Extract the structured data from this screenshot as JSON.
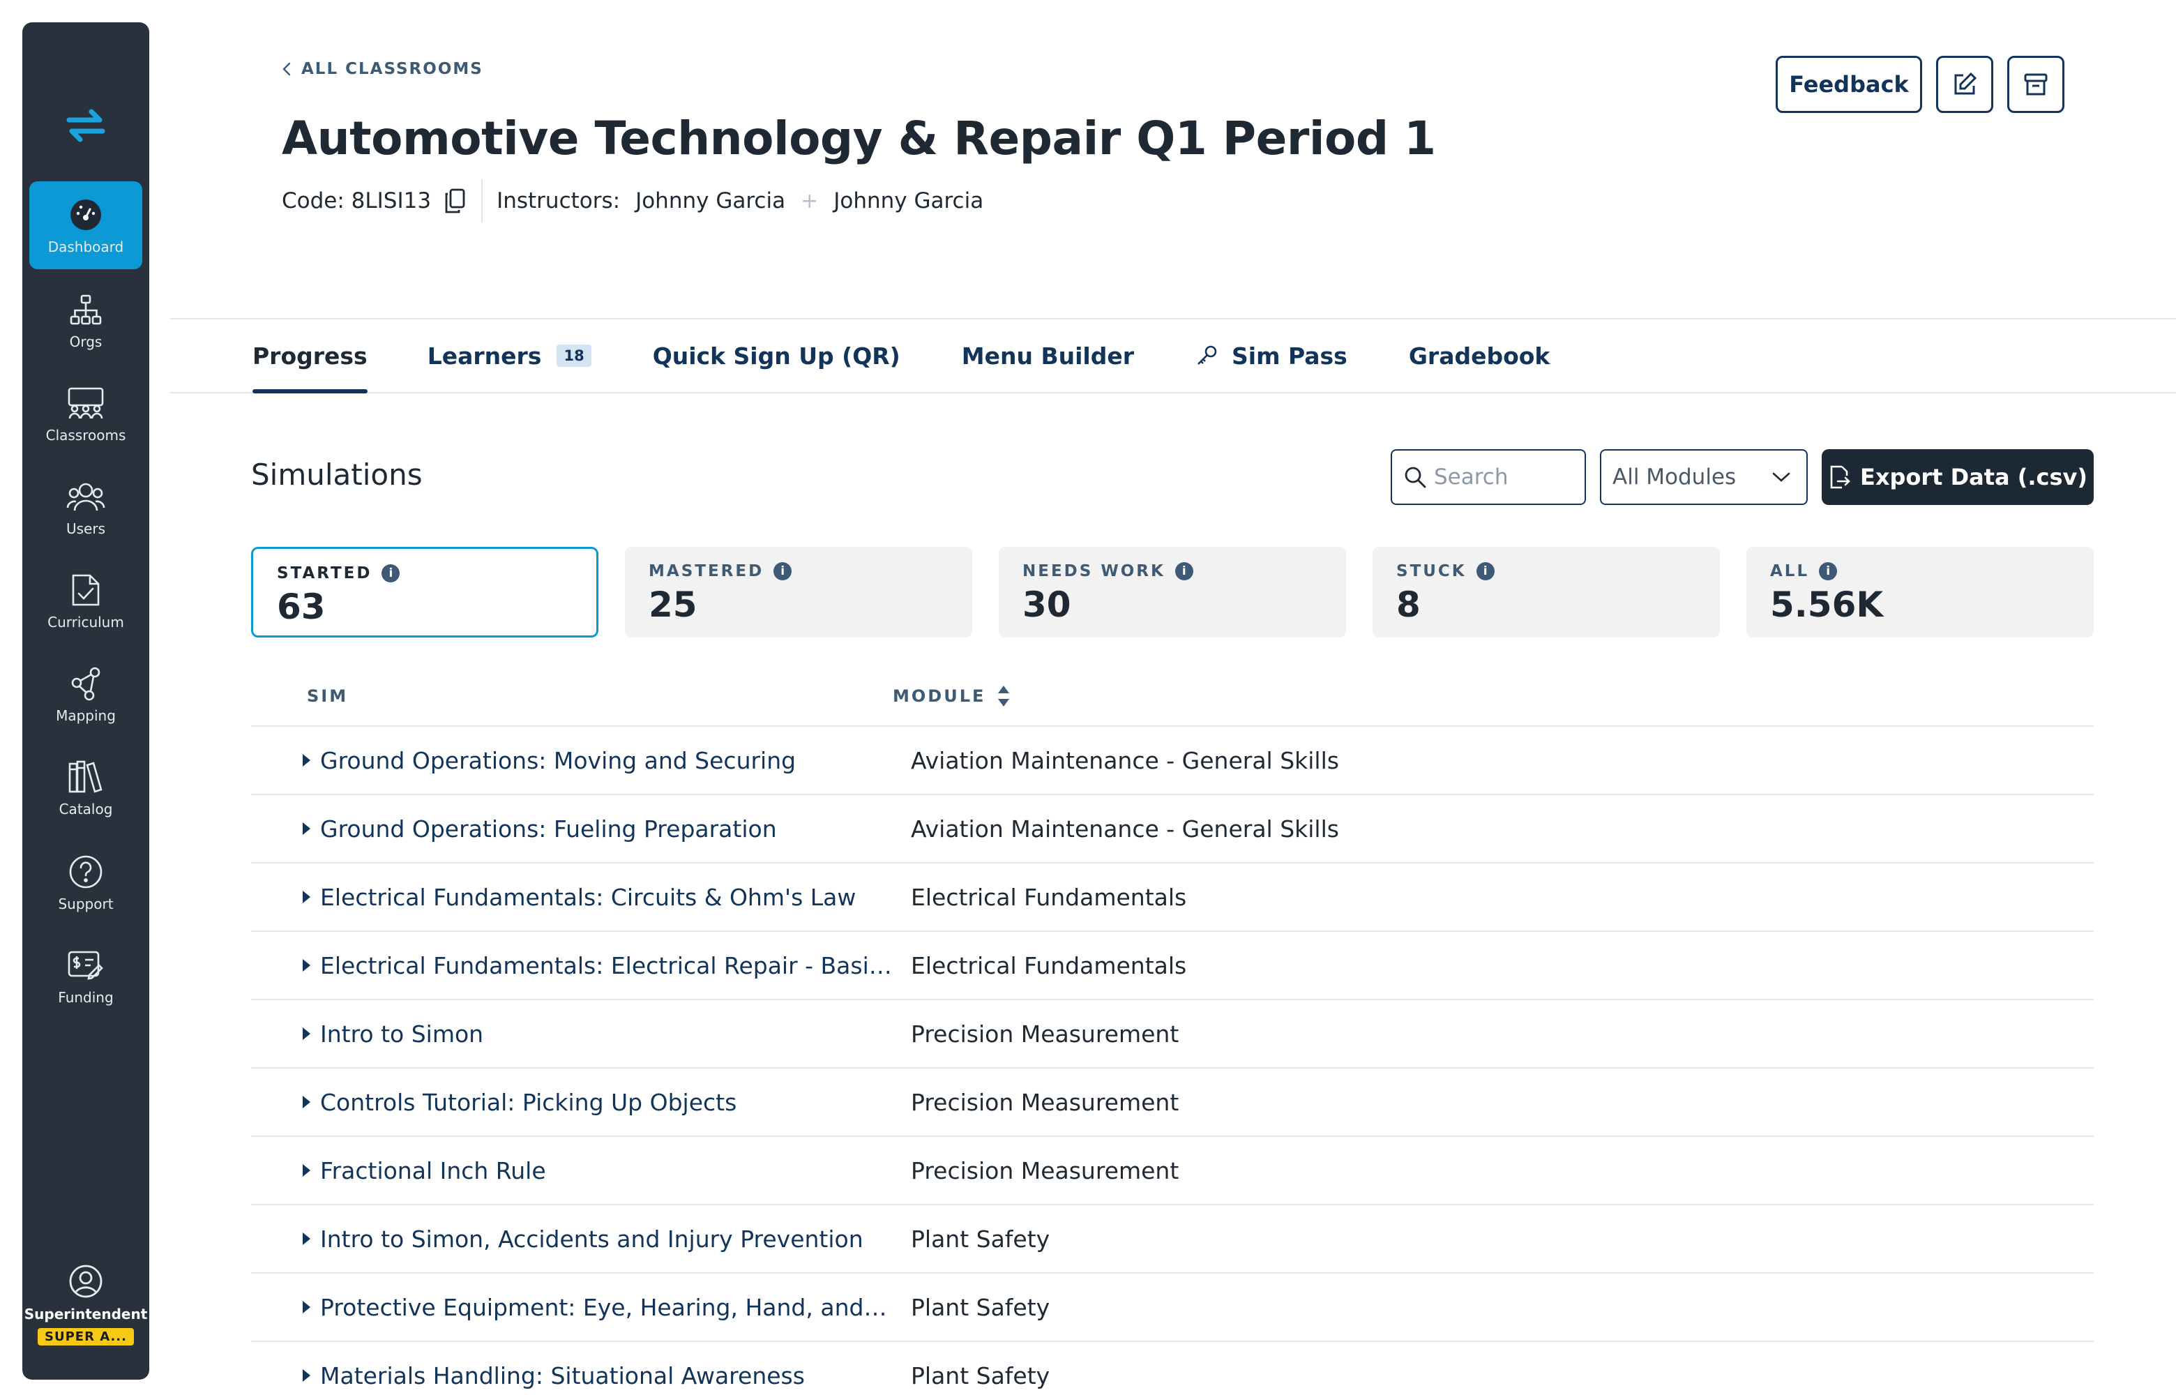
{
  "sidebar": {
    "items": [
      {
        "label": "Dashboard",
        "icon": "gauge-icon"
      },
      {
        "label": "Orgs",
        "icon": "org-chart-icon"
      },
      {
        "label": "Classrooms",
        "icon": "classroom-icon"
      },
      {
        "label": "Users",
        "icon": "users-icon"
      },
      {
        "label": "Curriculum",
        "icon": "document-check-icon"
      },
      {
        "label": "Mapping",
        "icon": "share-nodes-icon"
      },
      {
        "label": "Catalog",
        "icon": "books-icon"
      },
      {
        "label": "Support",
        "icon": "question-circle-icon"
      },
      {
        "label": "Funding",
        "icon": "funding-icon"
      }
    ],
    "user": {
      "name": "Superintendent",
      "role": "SUPER A..."
    }
  },
  "header": {
    "breadcrumb": "ALL CLASSROOMS",
    "title": "Automotive Technology & Repair Q1 Period 1",
    "code": "Code: 8LISI13",
    "instructors_label": "Instructors:",
    "instructors": [
      "Johnny Garcia",
      "Johnny Garcia"
    ],
    "feedback_label": "Feedback"
  },
  "tabs": [
    {
      "label": "Progress",
      "active": true
    },
    {
      "label": "Learners",
      "count": "18"
    },
    {
      "label": "Quick Sign Up (QR)"
    },
    {
      "label": "Menu Builder"
    },
    {
      "label": "Sim Pass",
      "icon": "key-icon"
    },
    {
      "label": "Gradebook"
    }
  ],
  "simulations": {
    "title": "Simulations",
    "search_placeholder": "Search",
    "module_filter": "All Modules",
    "export_label": "Export Data (.csv)",
    "stats": [
      {
        "label": "STARTED",
        "value": "63",
        "active": true
      },
      {
        "label": "MASTERED",
        "value": "25"
      },
      {
        "label": "NEEDS WORK",
        "value": "30"
      },
      {
        "label": "STUCK",
        "value": "8"
      },
      {
        "label": "ALL",
        "value": "5.56K"
      }
    ],
    "columns": {
      "sim": "SIM",
      "module": "MODULE"
    },
    "rows": [
      {
        "sim": "Ground Operations: Moving and Securing",
        "module": "Aviation Maintenance - General Skills"
      },
      {
        "sim": "Ground Operations: Fueling Preparation",
        "module": "Aviation Maintenance - General Skills"
      },
      {
        "sim": "Electrical Fundamentals: Circuits & Ohm's Law",
        "module": "Electrical Fundamentals"
      },
      {
        "sim": "Electrical Fundamentals: Electrical Repair - Basic ...",
        "module": "Electrical Fundamentals"
      },
      {
        "sim": "Intro to Simon",
        "module": "Precision Measurement"
      },
      {
        "sim": "Controls Tutorial: Picking Up Objects",
        "module": "Precision Measurement"
      },
      {
        "sim": "Fractional Inch Rule",
        "module": "Precision Measurement"
      },
      {
        "sim": "Intro to Simon, Accidents and Injury Prevention",
        "module": "Plant Safety"
      },
      {
        "sim": "Protective Equipment: Eye, Hearing, Hand, and Foo...",
        "module": "Plant Safety"
      },
      {
        "sim": "Materials Handling: Situational Awareness",
        "module": "Plant Safety"
      }
    ]
  },
  "colors": {
    "accent": "#0b9ad6",
    "navy": "#13345a",
    "sidebar": "#29323c",
    "badge": "#f6c915"
  }
}
